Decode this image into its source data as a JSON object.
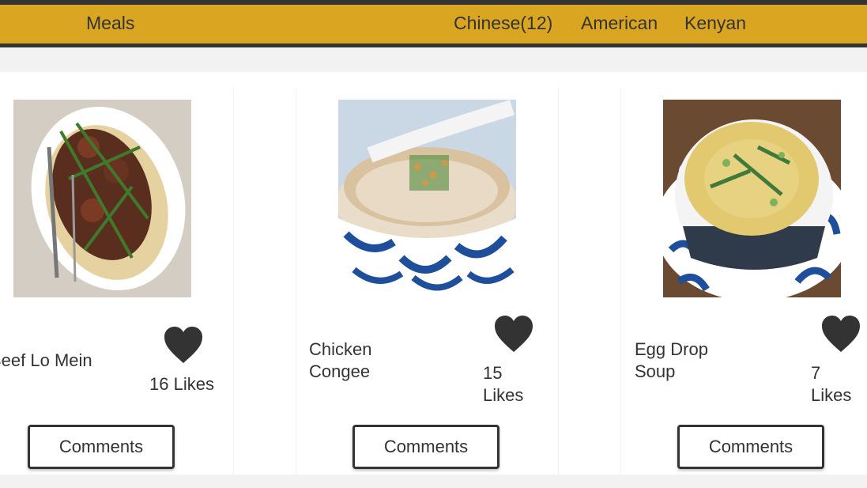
{
  "nav": {
    "brand": "Meals",
    "links": [
      "Chinese(12)",
      "American",
      "Kenyan"
    ]
  },
  "meals": [
    {
      "name": "Beef Lo Mein",
      "likes": "16 Likes",
      "comments_label": "Comments"
    },
    {
      "name": "Chicken Congee",
      "likes": "15 Likes",
      "comments_label": "Comments"
    },
    {
      "name": "Egg Drop Soup",
      "likes": "7 Likes",
      "comments_label": "Comments"
    }
  ],
  "colors": {
    "navbar": "#daa520",
    "dark": "#333333",
    "page_bg": "#f2f2f2",
    "card_bg": "#ffffff"
  },
  "icons": {
    "like": "heart-icon"
  }
}
